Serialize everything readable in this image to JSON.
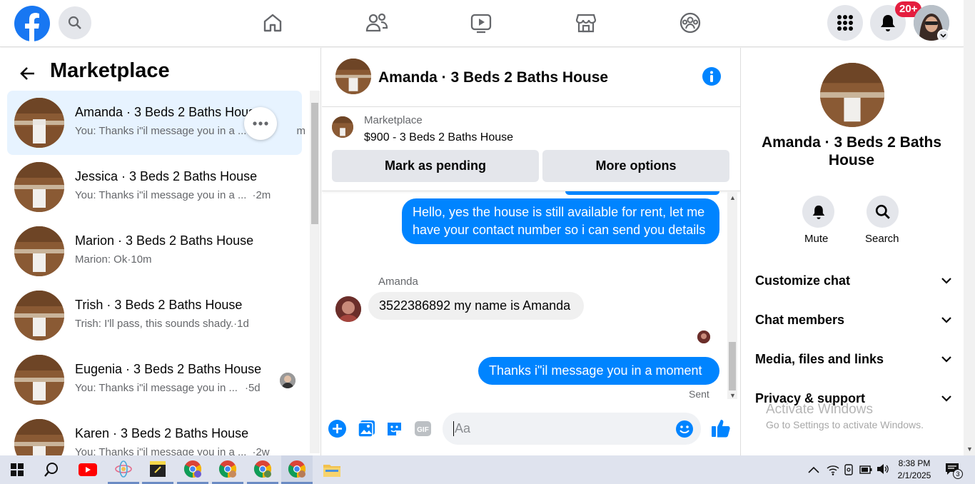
{
  "topbar": {
    "notifications_badge": "20+",
    "icons": [
      "facebook-logo",
      "search-icon",
      "home-icon",
      "friends-icon",
      "video-icon",
      "marketplace-icon",
      "groups-icon",
      "menu-grid-icon",
      "bell-icon",
      "avatar"
    ]
  },
  "left": {
    "title": "Marketplace",
    "conversations": [
      {
        "title": "Amanda · 3 Beds 2 Baths House",
        "preview": "You: Thanks i\"il message you in a ...",
        "time": "m",
        "active": true
      },
      {
        "title": "Jessica · 3 Beds 2 Baths House",
        "preview": "You: Thanks i\"il message you in a ...",
        "time": "·2m"
      },
      {
        "title": "Marion · 3 Beds 2 Baths House",
        "preview": "Marion: Ok",
        "time": "·10m"
      },
      {
        "title": "Trish · 3 Beds 2 Baths House",
        "preview": "Trish: I'll pass, this sounds shady.",
        "time": "·1d"
      },
      {
        "title": "Eugenia · 3 Beds 2 Baths House",
        "preview": "You: Thanks i\"il message you in ...",
        "time": "·5d"
      },
      {
        "title": "Karen · 3 Beds 2 Baths House",
        "preview": "You: Thanks i\"il message you in a ...",
        "time": "·2w"
      }
    ]
  },
  "chat": {
    "header_title": "Amanda · 3 Beds 2 Baths House",
    "listing_label": "Marketplace",
    "listing_price_title": "$900 - 3 Beds 2 Baths House",
    "mark_pending": "Mark as pending",
    "more_options": "More options",
    "msg_out_1": "Hello, yes the house is still available for rent, let me have your contact number so i can send you details",
    "sender_name": "Amanda",
    "msg_in_1": "3522386892 my name is Amanda",
    "msg_out_2": "Thanks i\"il message you in a moment",
    "sent_status": "Sent",
    "composer_placeholder": "Aa"
  },
  "right": {
    "title": "Amanda · 3 Beds 2 Baths House",
    "mute_label": "Mute",
    "search_label": "Search",
    "sections": [
      "Customize chat",
      "Chat members",
      "Media, files and links",
      "Privacy & support"
    ],
    "watermark_title": "Activate Windows",
    "watermark_sub": "Go to Settings to activate Windows."
  },
  "taskbar": {
    "time": "8:38 PM",
    "date": "2/1/2025",
    "notif_count": "3"
  },
  "colors": {
    "accent": "#0084ff",
    "fb_blue": "#1877f2",
    "badge_red": "#e41e3f"
  }
}
